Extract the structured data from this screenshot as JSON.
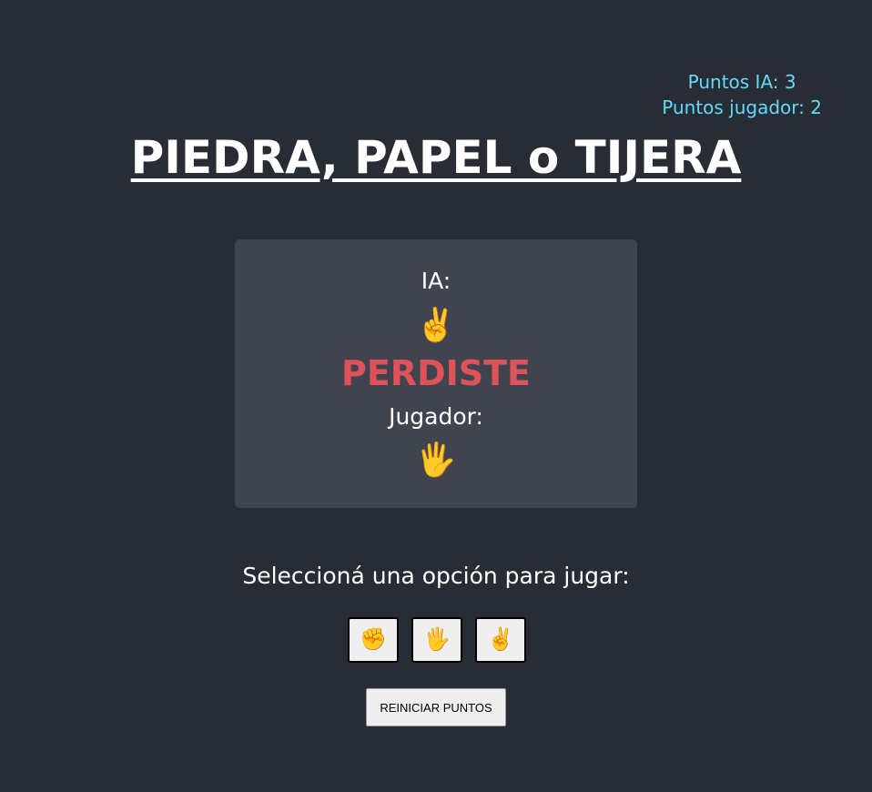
{
  "scores": {
    "ia": "Puntos IA: 3",
    "player": "Puntos jugador: 2"
  },
  "title": "PIEDRA, PAPEL o TIJERA",
  "board": {
    "ia_label": "IA:",
    "ia_choice": "✌️",
    "result": "PERDISTE",
    "player_label": "Jugador:",
    "player_choice": "🖐️"
  },
  "prompt": "Seleccioná una opción para jugar:",
  "options": [
    {
      "name": "piedra",
      "emoji": "✊"
    },
    {
      "name": "papel",
      "emoji": "🖐️"
    },
    {
      "name": "tijera",
      "emoji": "✌️"
    }
  ],
  "reset_label": "REINICIAR PUNTOS",
  "colors": {
    "background": "#282c35",
    "board": "#40444e",
    "scores": "#61dafb",
    "result_lose": "#e0525a"
  }
}
